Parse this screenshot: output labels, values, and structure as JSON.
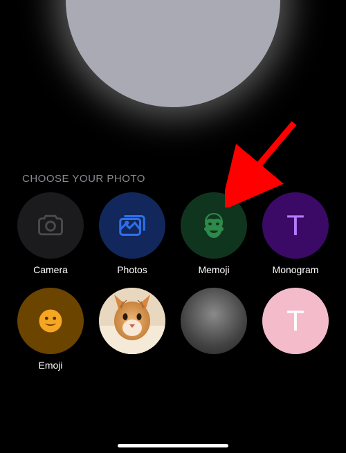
{
  "section_title": "CHOOSE YOUR PHOTO",
  "options": {
    "camera": {
      "label": "Camera"
    },
    "photos": {
      "label": "Photos"
    },
    "memoji": {
      "label": "Memoji"
    },
    "monogram": {
      "label": "Monogram",
      "letter": "T"
    },
    "emoji": {
      "label": "Emoji"
    },
    "pink_monogram": {
      "letter": "T"
    }
  },
  "colors": {
    "camera_bg": "#1b1b1d",
    "photos_bg": "#12275b",
    "memoji_bg": "#10351f",
    "monogram_bg": "#3a0a66",
    "emoji_bg": "#6b4400",
    "pink_bg": "#f4bccb",
    "arrow": "#ff0000"
  }
}
